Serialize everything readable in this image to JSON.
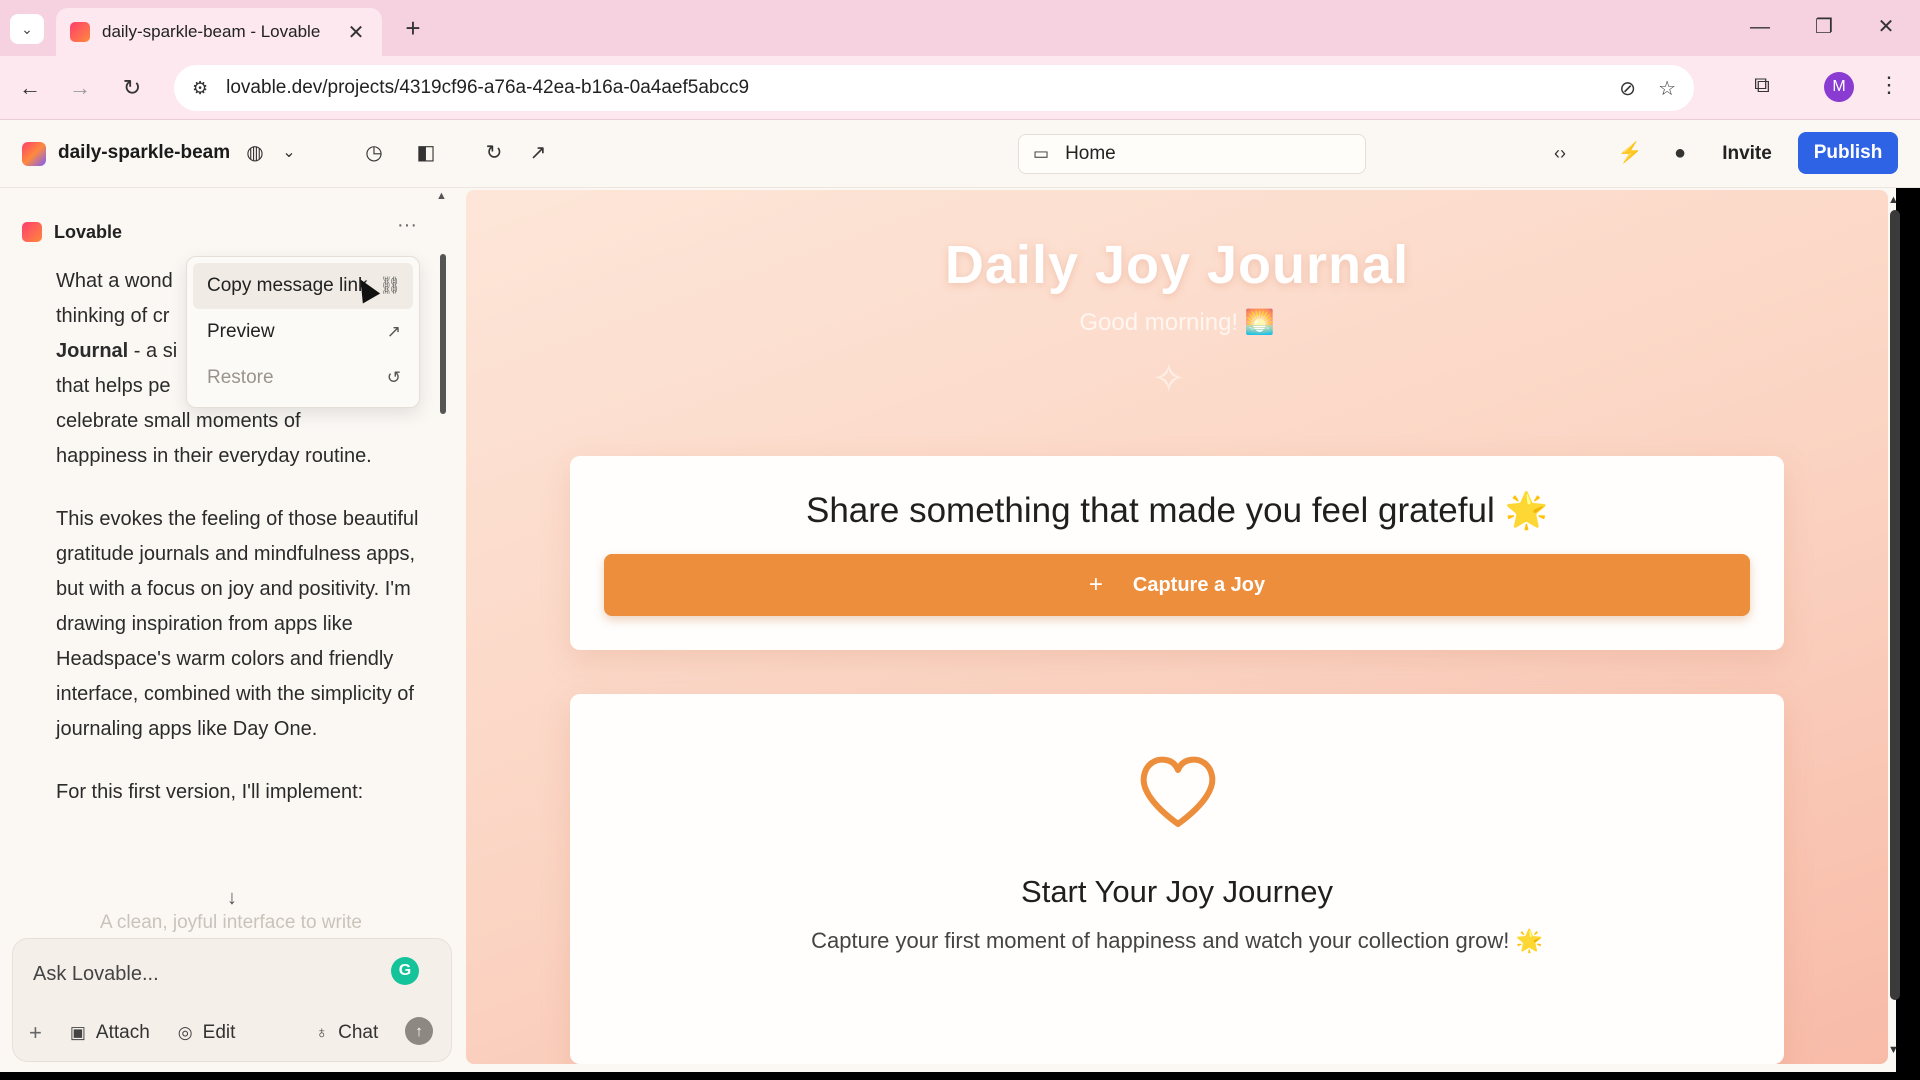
{
  "browser": {
    "tab_title": "daily-sparkle-beam - Lovable",
    "url": "lovable.dev/projects/4319cf96-a76a-42ea-b16a-0a4aef5abcc9",
    "profile_initial": "M",
    "icons": {
      "tab_list": "chevron-down-icon",
      "close_tab": "close-icon",
      "new_tab": "plus-icon",
      "back": "arrow-left-icon",
      "forward": "arrow-right-icon",
      "reload": "reload-icon",
      "site_info": "tune-icon",
      "eye_off": "eye-off-icon",
      "bookmark": "star-icon",
      "extensions": "puzzle-icon",
      "menu": "kebab-icon"
    }
  },
  "app_header": {
    "project_name": "daily-sparkle-beam",
    "route": "Home",
    "invite_label": "Invite",
    "publish_label": "Publish",
    "accent_color": "#2f63e6"
  },
  "chat": {
    "author": "Lovable",
    "paragraph1_a": "What a wond",
    "paragraph1_b": "thinking of cr",
    "paragraph1_c_bold": "Journal",
    "paragraph1_c": " - a si",
    "paragraph1_d": "that helps pe",
    "paragraph1_e": "celebrate small moments of",
    "paragraph1_f": "happiness in their everyday routine.",
    "paragraph2": "This evokes the feeling of those beautiful gratitude journals and mindfulness apps, but with a focus on joy and positivity. I'm drawing inspiration from apps like Headspace's warm colors and friendly interface, combined with the simplicity of journaling apps like Day One.",
    "paragraph3": "For this first version, I'll implement:",
    "faded_line": "A clean, joyful interface to write",
    "context_menu": {
      "items": [
        {
          "label": "Copy message link",
          "icon": "link-icon"
        },
        {
          "label": "Preview",
          "icon": "arrow-up-right-icon"
        },
        {
          "label": "Restore",
          "icon": "restore-icon"
        }
      ]
    },
    "input": {
      "placeholder": "Ask Lovable...",
      "attach_label": "Attach",
      "edit_label": "Edit",
      "chat_label": "Chat"
    }
  },
  "preview": {
    "title": "Daily Joy Journal",
    "greeting": "Good morning! 🌅",
    "prompt_title": "Share something that made you feel grateful 🌟",
    "capture_label": "Capture a Joy",
    "empty_title": "Start Your Joy Journey",
    "empty_text": "Capture your first moment of happiness and watch your collection grow! 🌟",
    "button_color": "#ec8e3b",
    "heart_color": "#ec8e3b"
  }
}
